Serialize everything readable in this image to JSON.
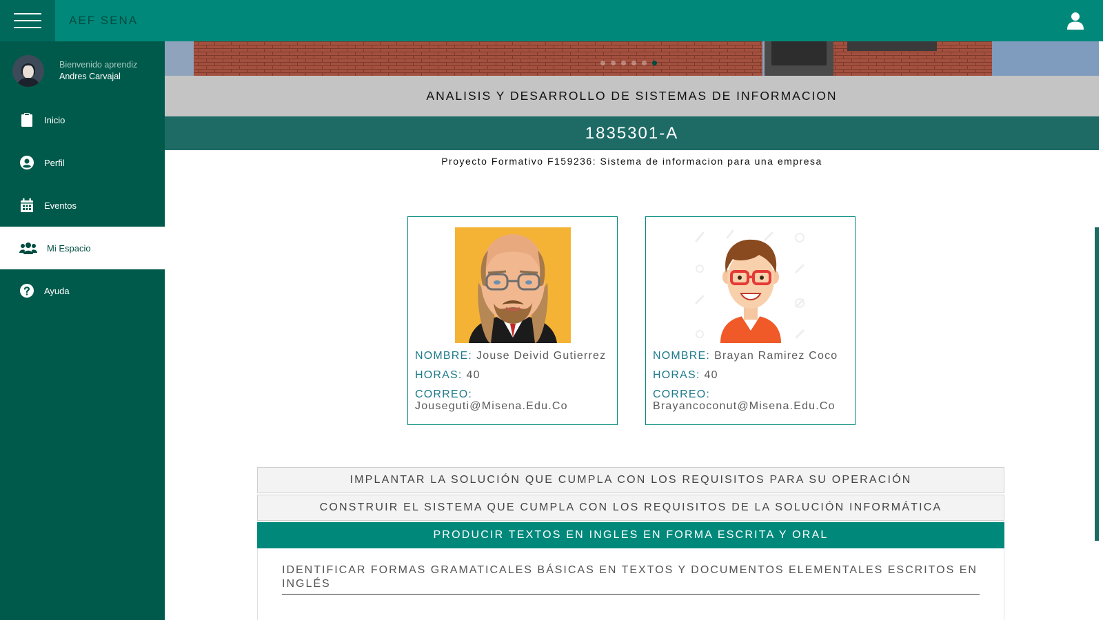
{
  "app": {
    "brand": "AEF SENA"
  },
  "header": {
    "menu_icon": "hamburger-icon",
    "user_icon": "user-icon"
  },
  "sidebar": {
    "welcome_label": "Bienvenido aprendiz",
    "user_name": "Andres Carvajal",
    "items": [
      {
        "label": "Inicio",
        "icon": "clipboard-icon",
        "active": false
      },
      {
        "label": "Perfil",
        "icon": "user-circle-icon",
        "active": false
      },
      {
        "label": "Eventos",
        "icon": "calendar-icon",
        "active": false
      },
      {
        "label": "Mi Espacio",
        "icon": "users-icon",
        "active": true
      },
      {
        "label": "Ayuda",
        "icon": "help-icon",
        "active": false
      }
    ]
  },
  "carousel": {
    "slide_count": 6,
    "active_index": 5
  },
  "program": {
    "title": "ANALISIS Y DESARROLLO DE SISTEMAS DE INFORMACION",
    "ficha": "1835301-A",
    "project": "Proyecto Formativo F159236: Sistema de informacion para una empresa"
  },
  "instructors": [
    {
      "name_label": "NOMBRE:",
      "name": "Jouse Deivid Gutierrez",
      "hours_label": "HORAS:",
      "hours": "40",
      "email_label": "CORREO:",
      "email": "Jouseguti@Misena.Edu.Co"
    },
    {
      "name_label": "NOMBRE:",
      "name": "Brayan Ramirez Coco",
      "hours_label": "HORAS:",
      "hours": "40",
      "email_label": "CORREO:",
      "email": "Brayancoconut@Misena.Edu.Co"
    }
  ],
  "competencies": [
    {
      "title": "IMPLANTAR LA SOLUCIÓN QUE CUMPLA CON LOS REQUISITOS PARA SU OPERACIÓN",
      "open": false
    },
    {
      "title": "CONSTRUIR EL SISTEMA QUE CUMPLA CON LOS REQUISITOS DE LA SOLUCIÓN INFORMÁTICA",
      "open": false
    },
    {
      "title": "PRODUCIR TEXTOS EN INGLES EN FORMA ESCRITA Y ORAL",
      "open": true,
      "results": [
        "IDENTIFICAR FORMAS GRAMATICALES BÁSICAS EN TEXTOS Y DOCUMENTOS ELEMENTALES ESCRITOS EN INGLÉS"
      ]
    }
  ],
  "colors": {
    "primary": "#00897b",
    "primary_dark": "#00695c",
    "sidebar": "#005a4b",
    "ficha_bar": "#1e6b66",
    "label_blue": "#1f7a8c"
  }
}
